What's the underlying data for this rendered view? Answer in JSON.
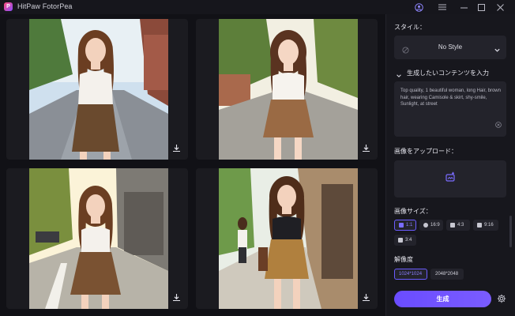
{
  "titlebar": {
    "app_name": "HitPaw FotorPea"
  },
  "panel": {
    "style_label": "スタイル：",
    "style_value": "No Style",
    "prompt_label": "生成したいコンテンツを入力",
    "prompt_text": "Top quality, 1 beautiful woman, long Hair, brown hair, wearing Camisole & skirt, shy-smile, Sunlight, at street",
    "upload_label": "画像をアップロード：",
    "size_label": "画像サイズ：",
    "sizes": [
      {
        "label": "1:1",
        "selected": true
      },
      {
        "label": "16:9",
        "selected": false
      },
      {
        "label": "4:3",
        "selected": false
      },
      {
        "label": "9:16",
        "selected": false
      },
      {
        "label": "3:4",
        "selected": false
      }
    ],
    "resolution_label": "解像度",
    "resolutions": [
      {
        "label": "1024*1024",
        "selected": true
      },
      {
        "label": "2048*2048",
        "selected": false
      }
    ],
    "generate_label": "生成"
  },
  "colors": {
    "accent": "#6b5cff",
    "background": "#111116",
    "panel": "#17171d"
  }
}
